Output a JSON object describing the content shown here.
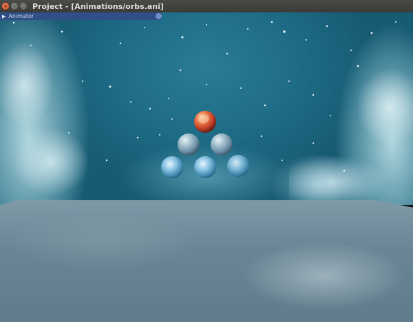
{
  "window": {
    "title": "Project - [Animations/orbs.ani]",
    "buttons": {
      "close": "×",
      "minimize": "–",
      "maximize": "▢"
    }
  },
  "animator": {
    "label": "Animator",
    "expand_icon": "▶"
  },
  "scene": {
    "orbs": [
      {
        "name": "orb-top",
        "material": "orange-marble"
      },
      {
        "name": "orb-mid-left",
        "material": "blue-stone"
      },
      {
        "name": "orb-mid-right",
        "material": "blue-stone"
      },
      {
        "name": "orb-bottom-left",
        "material": "glass-blue"
      },
      {
        "name": "orb-bottom-center",
        "material": "glass-blue"
      },
      {
        "name": "orb-bottom-right",
        "material": "glass-blue"
      }
    ],
    "colors": {
      "sky": "#1d6a84",
      "floor": "#6a8695",
      "orange_orb": "#e0603a",
      "blue_orb": "#7fb3cf"
    }
  }
}
